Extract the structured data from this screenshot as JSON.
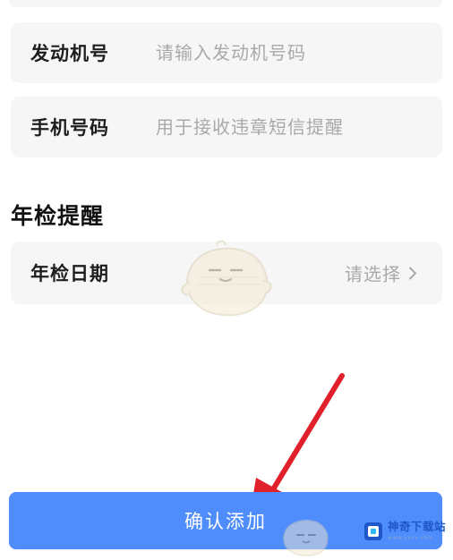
{
  "form": {
    "engine_number": {
      "label": "发动机号",
      "placeholder": "请输入发动机号码",
      "value": ""
    },
    "phone_number": {
      "label": "手机号码",
      "placeholder": "用于接收违章短信提醒",
      "value": ""
    }
  },
  "inspection_reminder": {
    "section_title": "年检提醒",
    "date_label": "年检日期",
    "date_value": "请选择"
  },
  "actions": {
    "confirm_label": "确认添加"
  },
  "watermark": {
    "title": "神奇下载站",
    "subtitle": "www.xxxx.com"
  },
  "colors": {
    "card_background": "#f6f6f6",
    "button_background": "#4e8dfb",
    "annotation_arrow": "#e0212b",
    "placeholder_text": "#a9a9a9"
  },
  "icons": {
    "chevron": "chevron-right-icon",
    "annotation": "red-arrow-annotation",
    "mascot": "mascot-watermark"
  }
}
